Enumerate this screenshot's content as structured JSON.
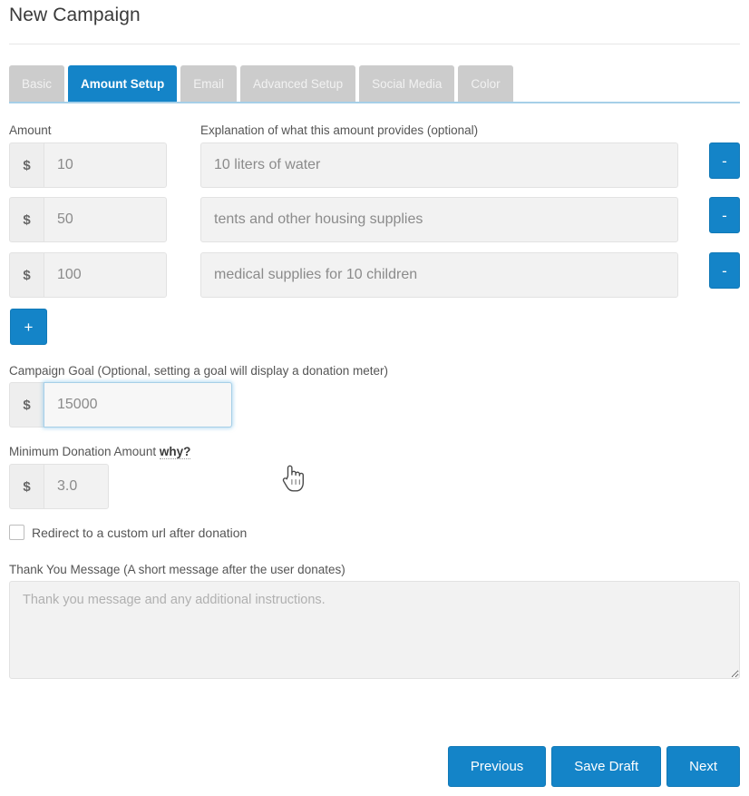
{
  "page": {
    "title": "New Campaign"
  },
  "tabs": [
    {
      "label": "Basic",
      "active": false
    },
    {
      "label": "Amount Setup",
      "active": true
    },
    {
      "label": "Email",
      "active": false
    },
    {
      "label": "Advanced Setup",
      "active": false
    },
    {
      "label": "Social Media",
      "active": false
    },
    {
      "label": "Color",
      "active": false
    }
  ],
  "amount_section": {
    "amount_label": "Amount",
    "explanation_label": "Explanation of what this amount provides (optional)",
    "currency_symbol": "$",
    "remove_button_label": "-",
    "add_button_label": "+",
    "rows": [
      {
        "amount": "10",
        "explanation": "10 liters of water"
      },
      {
        "amount": "50",
        "explanation": "tents and other housing supplies"
      },
      {
        "amount": "100",
        "explanation": "medical supplies for 10 children"
      }
    ]
  },
  "campaign_goal": {
    "label": "Campaign Goal (Optional, setting a goal will display a donation meter)",
    "currency_symbol": "$",
    "value": "15000"
  },
  "minimum_donation": {
    "label": "Minimum Donation Amount",
    "why_link": "why?",
    "currency_symbol": "$",
    "value": "3.0"
  },
  "redirect": {
    "label": "Redirect to a custom url after donation",
    "checked": false
  },
  "thank_you": {
    "label": "Thank You Message (A short message after the user donates)",
    "placeholder": "Thank you message and any additional instructions.",
    "value": ""
  },
  "footer": {
    "previous_label": "Previous",
    "save_draft_label": "Save Draft",
    "next_label": "Next"
  },
  "colors": {
    "accent_blue": "#1484c8",
    "tab_inactive": "#cccccc",
    "input_bg": "#f2f2f2",
    "underline_blue": "#a6cfe8"
  }
}
